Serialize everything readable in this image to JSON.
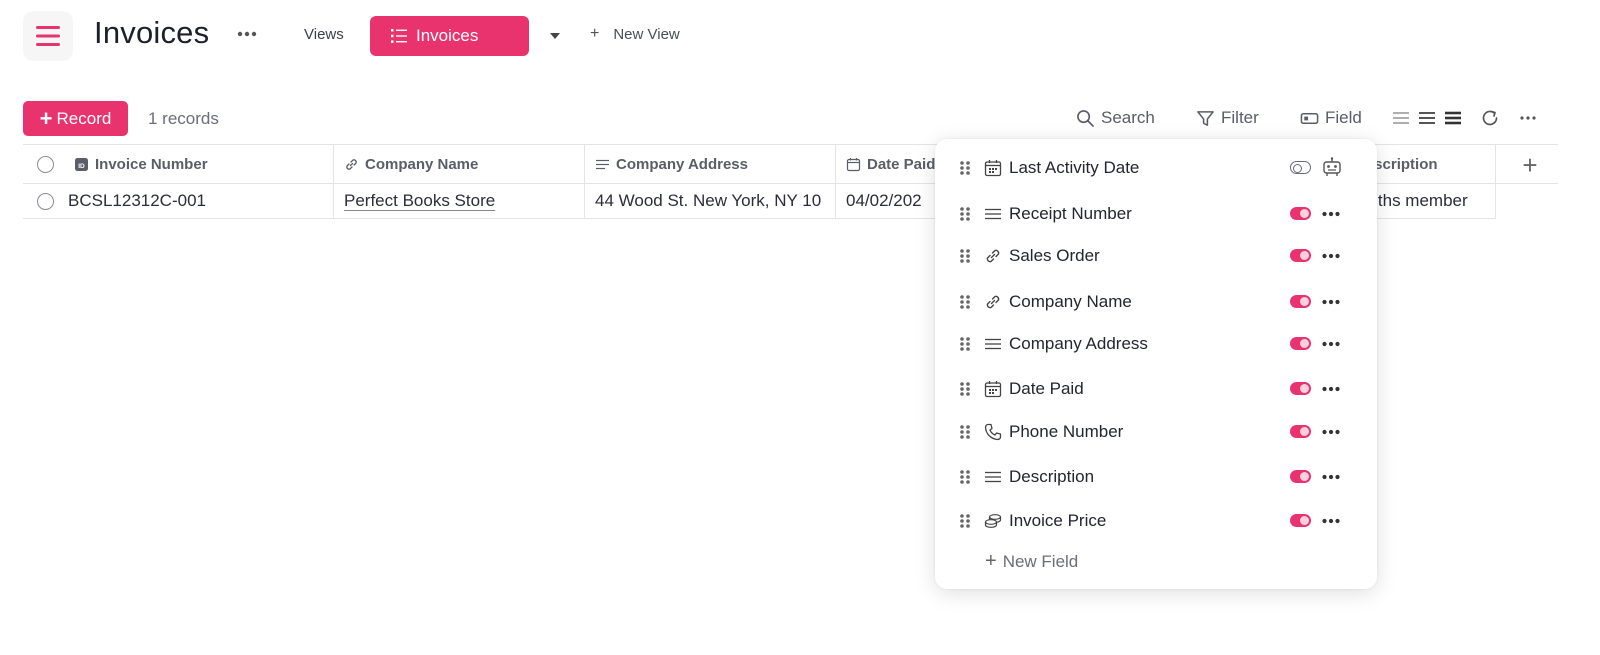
{
  "header": {
    "title": "Invoices",
    "views_label": "Views",
    "active_view": "Invoices",
    "new_view_label": "New View"
  },
  "toolbar": {
    "record_label": "Record",
    "records_count": "1 records",
    "search_label": "Search",
    "filter_label": "Filter",
    "field_label": "Field"
  },
  "table": {
    "columns": [
      {
        "label": "Invoice Number",
        "icon": "id-icon"
      },
      {
        "label": "Company Name",
        "icon": "link-icon"
      },
      {
        "label": "Company Address",
        "icon": "text-lines-icon"
      },
      {
        "label": "Date Paid",
        "icon": "calendar-icon"
      },
      {
        "label": "Description",
        "icon": "text-lines-icon"
      }
    ],
    "rows": [
      {
        "invoice_number": "BCSL12312C-001",
        "company_name": "Perfect Books Store",
        "company_address": "44 Wood St. New York, NY 10",
        "date_paid": "04/02/202",
        "description": "onths member"
      }
    ]
  },
  "fields_popup": {
    "items": [
      {
        "label": "Last Activity Date",
        "icon": "calendar-icon",
        "visible": false
      },
      {
        "label": "Receipt Number",
        "icon": "text-lines-icon",
        "visible": true
      },
      {
        "label": "Sales Order",
        "icon": "link-icon",
        "visible": true
      },
      {
        "label": "Company Name",
        "icon": "link-icon",
        "visible": true
      },
      {
        "label": "Company Address",
        "icon": "text-lines-icon",
        "visible": true
      },
      {
        "label": "Date Paid",
        "icon": "calendar-icon",
        "visible": true
      },
      {
        "label": "Phone Number",
        "icon": "phone-icon",
        "visible": true
      },
      {
        "label": "Description",
        "icon": "text-lines-icon",
        "visible": true
      },
      {
        "label": "Invoice Price",
        "icon": "coins-icon",
        "visible": true
      }
    ],
    "new_field_label": "New Field"
  },
  "colors": {
    "accent": "#e8336f",
    "text": "#1f2230",
    "muted": "#6b6e79",
    "border": "#e4e4e8"
  }
}
